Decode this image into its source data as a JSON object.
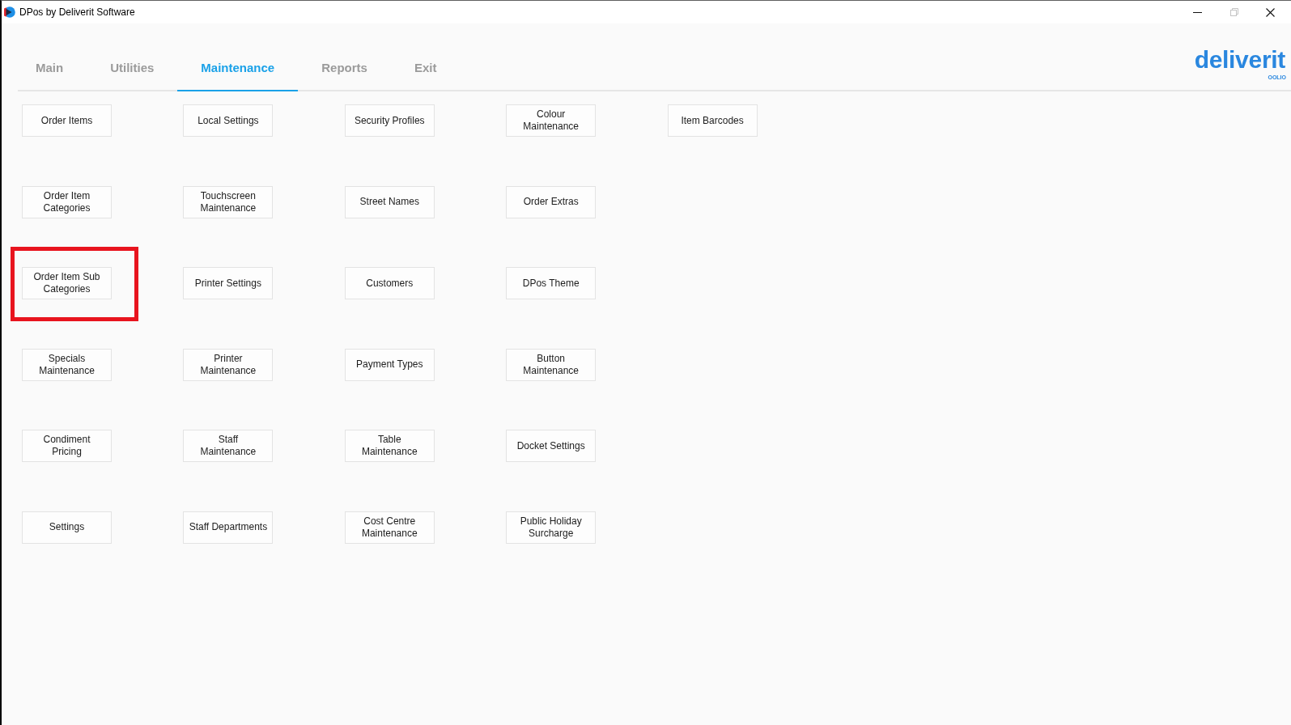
{
  "window": {
    "title": "DPos by Deliverit Software",
    "controls": [
      {
        "kind": "minimize",
        "disabled": false
      },
      {
        "kind": "restore",
        "disabled": true
      },
      {
        "kind": "close",
        "disabled": false
      }
    ]
  },
  "tabs": [
    {
      "label": "Main",
      "selected": false
    },
    {
      "label": "Utilities",
      "selected": false
    },
    {
      "label": "Maintenance",
      "selected": true
    },
    {
      "label": "Reports",
      "selected": false
    },
    {
      "label": "Exit",
      "selected": false
    }
  ],
  "logo": {
    "wordmark": "deliverit",
    "tagline": "OOLIO"
  },
  "button_rows": [
    {
      "buttons": [
        {
          "label": "Order Items",
          "highlighted": false
        },
        {
          "label": "Local Settings",
          "highlighted": false
        },
        {
          "label": "Security Profiles",
          "highlighted": false
        },
        {
          "label": "Colour\nMaintenance",
          "highlighted": false
        },
        {
          "label": "Item Barcodes",
          "highlighted": false
        }
      ]
    },
    {
      "buttons": [
        {
          "label": "Order Item\nCategories",
          "highlighted": false
        },
        {
          "label": "Touchscreen\nMaintenance",
          "highlighted": false
        },
        {
          "label": "Street Names",
          "highlighted": false
        },
        {
          "label": "Order Extras",
          "highlighted": false
        }
      ]
    },
    {
      "buttons": [
        {
          "label": "Order Item Sub\nCategories",
          "highlighted": true
        },
        {
          "label": "Printer Settings",
          "highlighted": false
        },
        {
          "label": "Customers",
          "highlighted": false
        },
        {
          "label": "DPos Theme",
          "highlighted": false
        }
      ]
    },
    {
      "buttons": [
        {
          "label": "Specials\nMaintenance",
          "highlighted": false
        },
        {
          "label": "Printer\nMaintenance",
          "highlighted": false
        },
        {
          "label": "Payment Types",
          "highlighted": false
        },
        {
          "label": "Button\nMaintenance",
          "highlighted": false
        }
      ]
    },
    {
      "buttons": [
        {
          "label": "Condiment\nPricing",
          "highlighted": false
        },
        {
          "label": "Staff\nMaintenance",
          "highlighted": false
        },
        {
          "label": "Table\nMaintenance",
          "highlighted": false
        },
        {
          "label": "Docket Settings",
          "highlighted": false
        }
      ]
    },
    {
      "buttons": [
        {
          "label": "Settings",
          "highlighted": false
        },
        {
          "label": "Staff Departments",
          "highlighted": false
        },
        {
          "label": "Cost Centre\nMaintenance",
          "highlighted": false
        },
        {
          "label": "Public Holiday\nSurcharge",
          "highlighted": false
        }
      ]
    }
  ]
}
